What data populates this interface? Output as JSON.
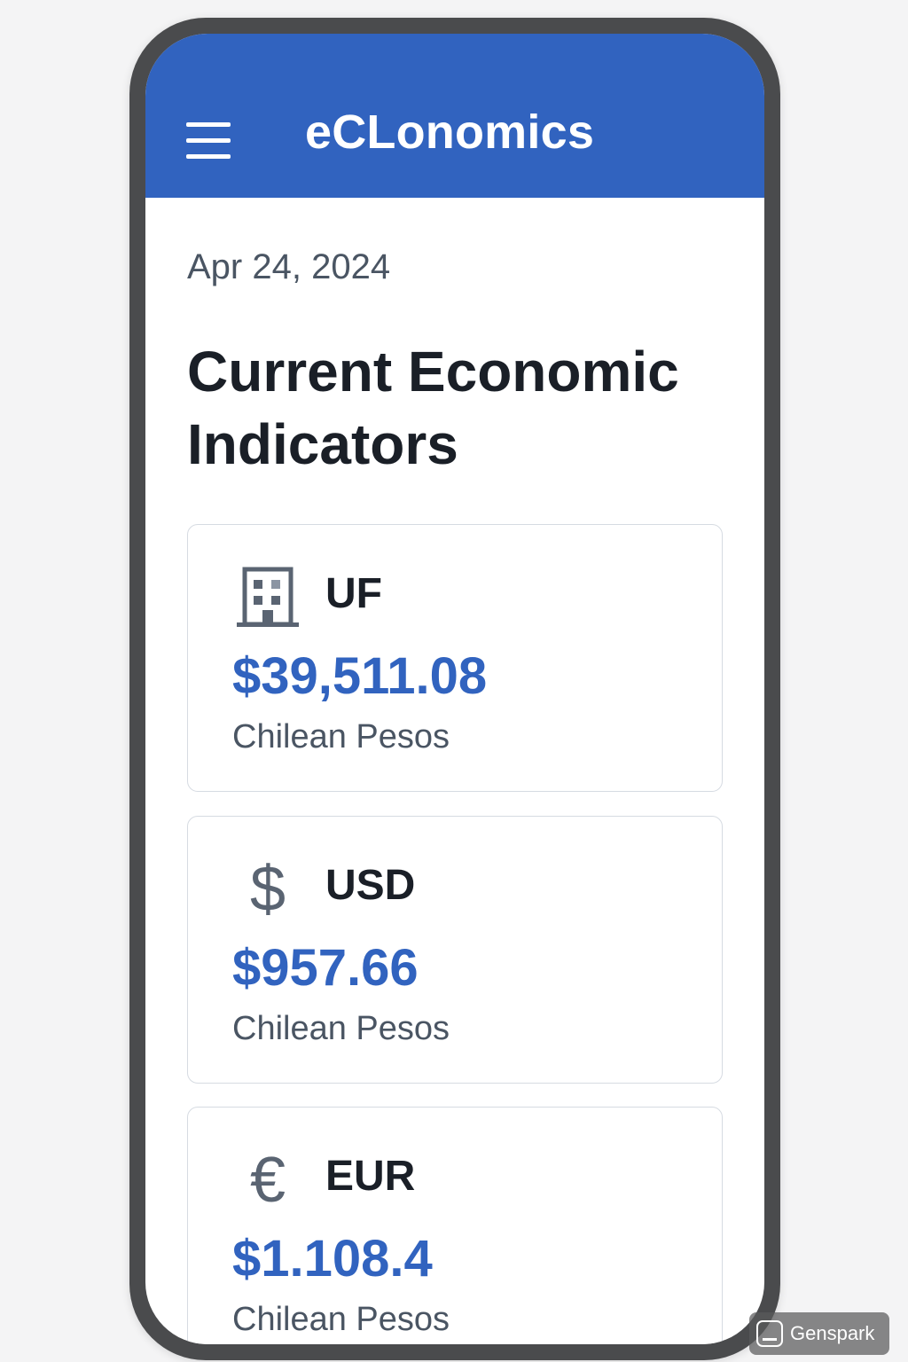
{
  "header": {
    "title": "eCLonomics",
    "menu_icon": "hamburger-menu-icon",
    "background_color": "#3163bf"
  },
  "main": {
    "date": "Apr 24, 2024",
    "heading": "Current Economic Indicators"
  },
  "indicators": [
    {
      "icon": "building-icon",
      "code": "UF",
      "value": "$39,511.08",
      "unit": "Chilean Pesos"
    },
    {
      "icon": "dollar-sign-icon",
      "code": "USD",
      "value": "$957.66",
      "unit": "Chilean Pesos"
    },
    {
      "icon": "euro-sign-icon",
      "code": "EUR",
      "value": "$1.108.4",
      "unit": "Chilean Pesos"
    }
  ],
  "colors": {
    "accent": "#3163bf",
    "text_dark": "#1a1f27",
    "text_muted": "#4a5563",
    "card_border": "#d6dbe2"
  },
  "watermark": {
    "text": "Genspark",
    "icon": "genspark-logo-icon"
  }
}
